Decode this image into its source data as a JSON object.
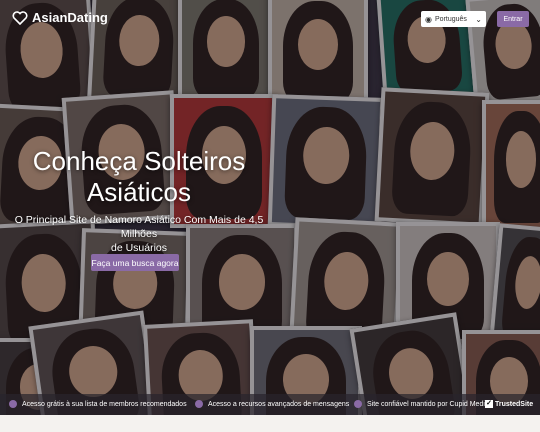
{
  "brand": {
    "name": "AsianDating",
    "accent": "#8a6aa6"
  },
  "header": {
    "language": {
      "selected": "Português",
      "icon": "globe-icon"
    },
    "signin_label": "Entrar"
  },
  "hero": {
    "title_line1": "Conheça Solteiros",
    "title_line2": "Asiáticos",
    "subtitle_line1": "O Principal Site de Namoro Asiático Com Mais de 4,5 Milhões",
    "subtitle_line2": "de Usuários",
    "cta_label": "Faça uma busca agora"
  },
  "features": [
    {
      "text": "Acesso grátis à sua lista de membros recomendados"
    },
    {
      "text": "Acesso a recursos avançados de mensagens"
    },
    {
      "text": "Site confiável mantido por Cupid Media"
    }
  ],
  "trusted": {
    "label": "TrustedSite"
  }
}
